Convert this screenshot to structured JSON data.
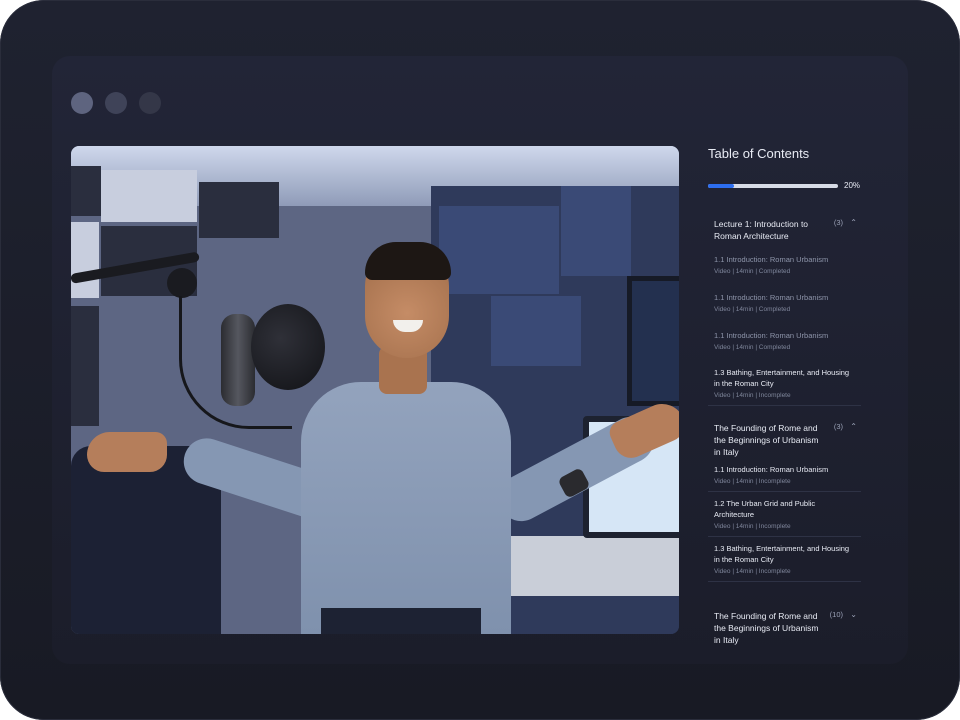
{
  "toc": {
    "title": "Table of Contents",
    "progress": {
      "label": "20%",
      "fraction": 0.2
    },
    "sections": [
      {
        "title": "Lecture 1: Introduction to Roman Architecture",
        "count": "(3)",
        "expanded": true,
        "lessons": [
          {
            "title": "1.1 Introduction: Roman Urbanism",
            "meta": "Video | 14min | Completed",
            "completed": true
          },
          {
            "title": "1.1 Introduction: Roman Urbanism",
            "meta": "Video | 14min | Completed",
            "completed": true
          },
          {
            "title": "1.1 Introduction: Roman Urbanism",
            "meta": "Video | 14min | Completed",
            "completed": true
          },
          {
            "title": "1.3 Bathing, Entertainment, and Housing in the Roman City",
            "meta": "Video | 14min | Incomplete",
            "completed": false
          }
        ]
      },
      {
        "title": "The Founding of Rome and the Beginnings of Urbanism in Italy",
        "count": "(3)",
        "expanded": true,
        "lessons": [
          {
            "title": "1.1 Introduction: Roman Urbanism",
            "meta": "Video | 14min | Incomplete",
            "completed": false
          },
          {
            "title": "1.2 The Urban Grid and Public Architecture",
            "meta": "Video | 14min | Incomplete",
            "completed": false
          },
          {
            "title": "1.3 Bathing, Entertainment, and Housing in the Roman City",
            "meta": "Video | 14min | Incomplete",
            "completed": false
          }
        ]
      },
      {
        "title": "The Founding of Rome and the Beginnings of Urbanism in Italy",
        "count": "(10)",
        "expanded": false,
        "lessons": []
      }
    ]
  },
  "icons": {
    "expanded": "chevron-up-icon",
    "collapsed": "chevron-down-icon"
  },
  "colors": {
    "accent": "#2d6ef0",
    "background": "#1f2230"
  }
}
